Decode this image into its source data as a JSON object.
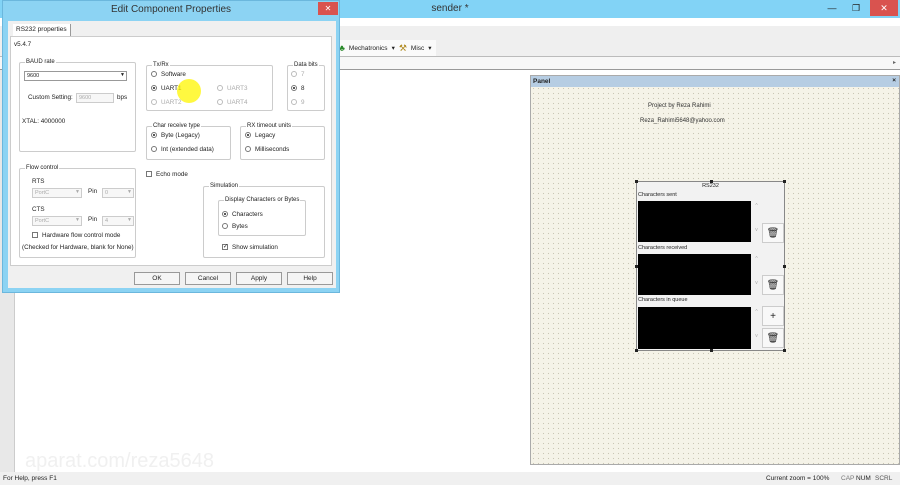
{
  "app": {
    "title": "sender *",
    "minimize": "—",
    "restore": "❐",
    "close": "✕"
  },
  "toolbar": {
    "mechatronics": "Mechatronics",
    "misc": "Misc",
    "arrow": "▾",
    "more": "▸"
  },
  "panel": {
    "title": "Panel",
    "close": "×",
    "project": "Project by Reza Rahimi",
    "email": "Reza_Rahimi5648@yahoo.com",
    "rs232": {
      "title": "RS232",
      "sent": "Characters sent",
      "received": "Characters received",
      "queue": "Characters in queue",
      "plus": "+",
      "trash": "🗑",
      "up": "^",
      "down": "v"
    }
  },
  "status": {
    "help": "For Help, press F1",
    "zoom": "Current zoom = 100%",
    "cap": "CAP",
    "num": "NUM",
    "scrl": "SCRL"
  },
  "watermark": "aparat.com/reza5648",
  "dialog": {
    "title": "Edit Component Properties",
    "close": "✕",
    "tab": "RS232 properties",
    "version": "v5.4.7",
    "baud": {
      "label": "BAUD rate",
      "value": "9600",
      "custom_label": "Custom Setting:",
      "custom_value": "9600",
      "unit": "bps",
      "xtal": "XTAL: 4000000"
    },
    "txrx": {
      "label": "Tx/Rx",
      "options": [
        "Software",
        "UART1",
        "UART2",
        "UART3",
        "UART4"
      ],
      "selected": "UART1"
    },
    "databits": {
      "label": "Data bits",
      "options": [
        "7",
        "8",
        "9"
      ],
      "selected": "8"
    },
    "charrecv": {
      "label": "Char receive type",
      "options": [
        "Byte (Legacy)",
        "Int (extended data)"
      ],
      "selected": "Byte (Legacy)"
    },
    "rxtimeout": {
      "label": "RX timeout units",
      "options": [
        "Legacy",
        "Milliseconds"
      ],
      "selected": "Legacy"
    },
    "flow": {
      "label": "Flow control",
      "rts": "RTS",
      "cts": "CTS",
      "rts_port": "PortC",
      "cts_port": "PortC",
      "pin": "Pin",
      "rts_pin": "0",
      "cts_pin": "4",
      "hw_mode": "Hardware flow control mode",
      "hint": "(Checked for Hardware, blank for None)"
    },
    "echo": "Echo mode",
    "sim": {
      "label": "Simulation",
      "display_label": "Display Characters or Bytes",
      "options": [
        "Characters",
        "Bytes"
      ],
      "selected": "Characters",
      "show": "Show simulation"
    },
    "buttons": {
      "ok": "OK",
      "cancel": "Cancel",
      "apply": "Apply",
      "help": "Help"
    }
  }
}
